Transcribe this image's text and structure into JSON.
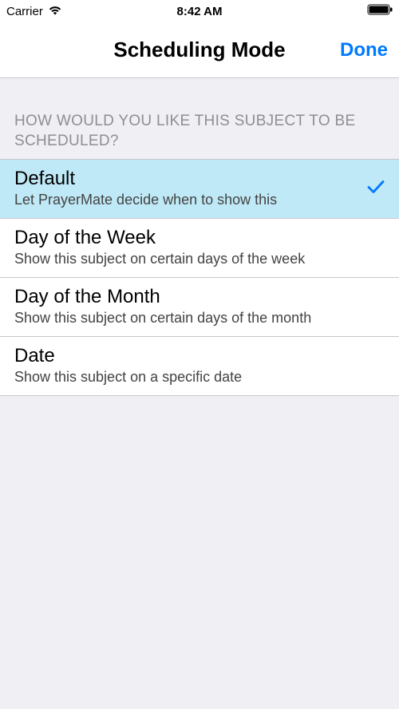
{
  "status_bar": {
    "carrier": "Carrier",
    "time": "8:42 AM"
  },
  "nav": {
    "title": "Scheduling Mode",
    "done": "Done"
  },
  "section_header": "HOW WOULD YOU LIKE THIS SUBJECT TO BE SCHEDULED?",
  "options": [
    {
      "title": "Default",
      "subtitle": "Let PrayerMate decide when to show this",
      "selected": true
    },
    {
      "title": "Day of the Week",
      "subtitle": "Show this subject on certain days of the week",
      "selected": false
    },
    {
      "title": "Day of the Month",
      "subtitle": "Show this subject on certain days of the month",
      "selected": false
    },
    {
      "title": "Date",
      "subtitle": "Show this subject on a specific date",
      "selected": false
    }
  ]
}
